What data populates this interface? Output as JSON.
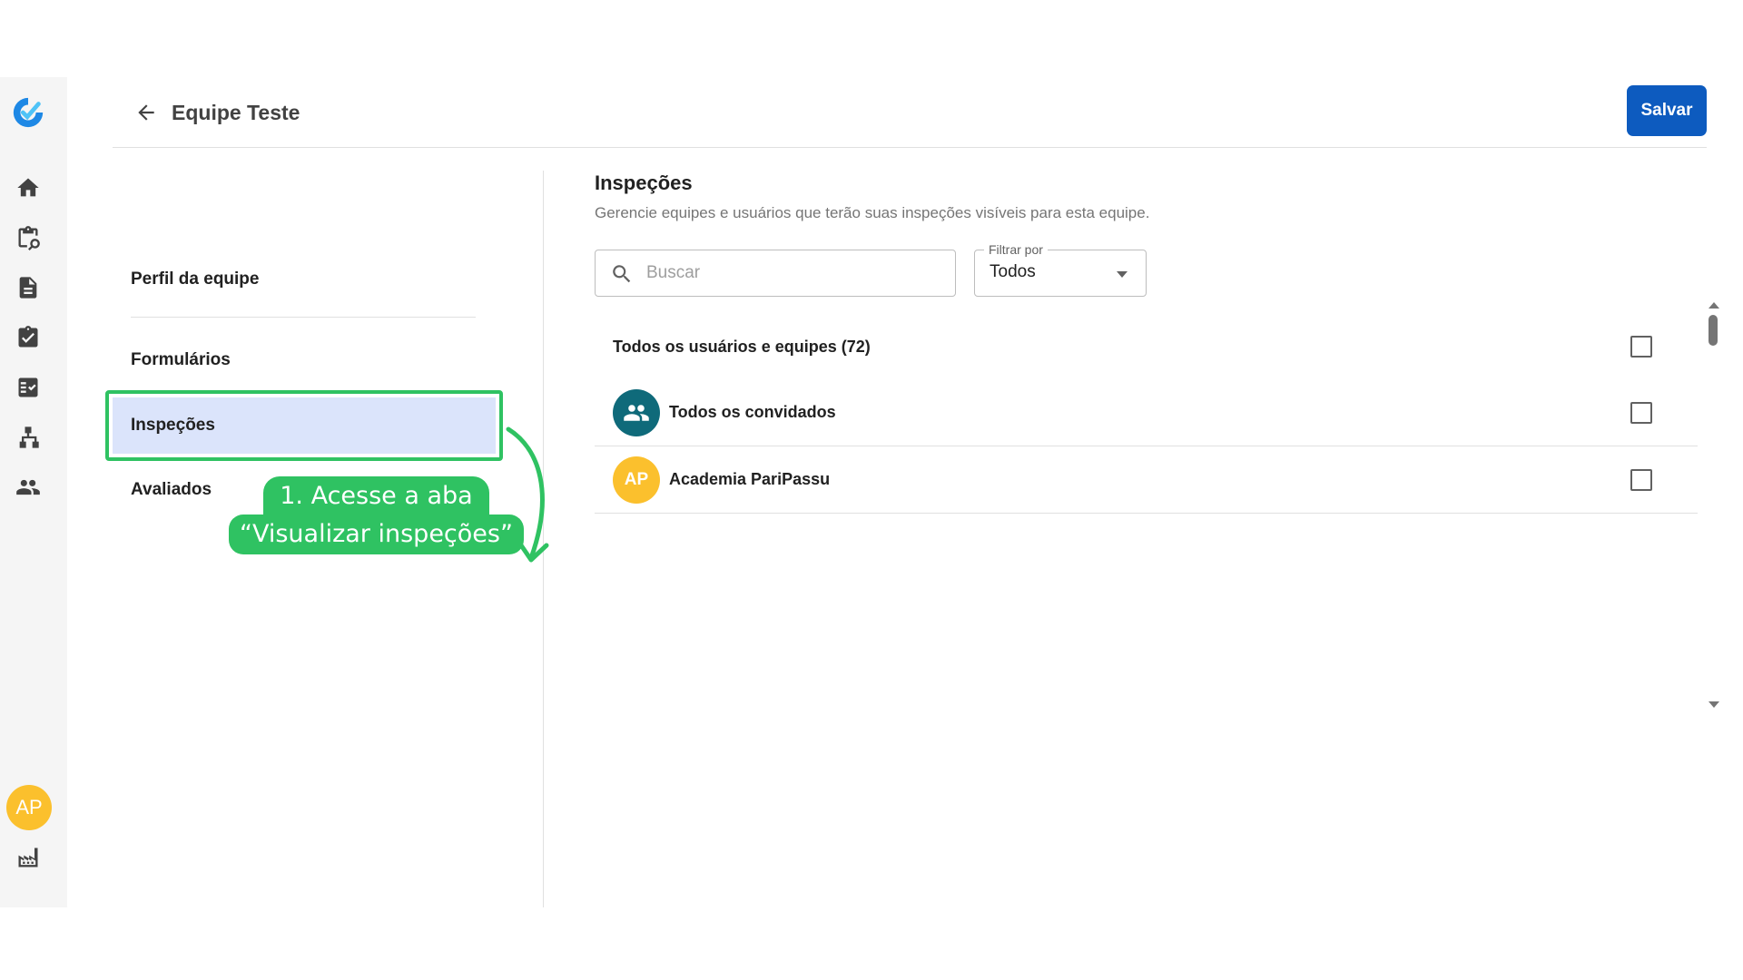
{
  "header": {
    "title": "Equipe Teste",
    "save_label": "Salvar"
  },
  "rail": {
    "avatar_initials": "AP",
    "icons": [
      "home-icon",
      "clipboard-search-icon",
      "document-icon",
      "clipboard-check-icon",
      "checklist-icon",
      "hierarchy-icon",
      "people-icon",
      "factory-icon"
    ]
  },
  "menu": {
    "items": [
      {
        "label": "Perfil da equipe"
      },
      {
        "label": "Formulários"
      },
      {
        "label": "Inspeções"
      },
      {
        "label": "Avaliados"
      }
    ]
  },
  "annotation": {
    "line1": "1. Acesse a aba",
    "line2": "“Visualizar inspeções”"
  },
  "main": {
    "title": "Inspeções",
    "subtitle": "Gerencie equipes e usuários que terão suas inspeções visíveis para esta equipe.",
    "search_placeholder": "Buscar",
    "filter_label": "Filtrar por",
    "filter_value": "Todos",
    "list": {
      "all_label": "Todos os usuários e equipes (72)",
      "rows": [
        {
          "label": "Todos os convidados",
          "avatar_color": "#0f6a7a"
        },
        {
          "label": "Academia PariPassu",
          "avatar_initials": "AP",
          "avatar_color": "#fbc02d"
        }
      ]
    }
  },
  "colors": {
    "accent": "#0d5bbf",
    "highlight_border": "#2fc262",
    "active_bg": "#dbe4fb"
  }
}
